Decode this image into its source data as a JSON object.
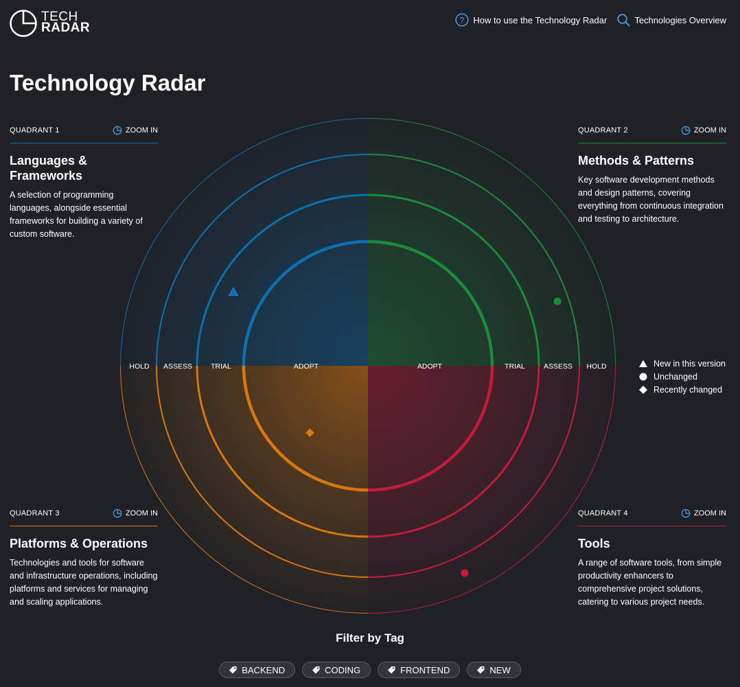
{
  "header": {
    "logo": {
      "line1": "TECH",
      "line2": "RADAR"
    },
    "nav": [
      {
        "label": "How to use the Technology Radar",
        "icon": "help-circle-icon"
      },
      {
        "label": "Technologies Overview",
        "icon": "search-icon"
      }
    ]
  },
  "page_title": "Technology Radar",
  "quadrants": [
    {
      "number_label": "QUADRANT 1",
      "zoom_label": "ZOOM IN",
      "title": "Languages & Frameworks",
      "description": "A selection of programming languages, alongside essential frameworks for building a variety of custom software.",
      "color": "#0e6fae"
    },
    {
      "number_label": "QUADRANT 2",
      "zoom_label": "ZOOM IN",
      "title": "Methods & Patterns",
      "description": "Key software development methods and design patterns, covering everything from continuous integration and testing to architecture.",
      "color": "#1c8a3c"
    },
    {
      "number_label": "QUADRANT 3",
      "zoom_label": "ZOOM IN",
      "title": "Platforms & Operations",
      "description": "Technologies and tools for software and infrastructure operations, including platforms and services for managing and scaling applications.",
      "color": "#d8770d"
    },
    {
      "number_label": "QUADRANT 4",
      "zoom_label": "ZOOM IN",
      "title": "Tools",
      "description": "A range of software tools, from simple productivity enhancers to comprehensive project solutions, catering to various project needs.",
      "color": "#c21a3a"
    }
  ],
  "radar": {
    "rings_left": [
      "HOLD",
      "ASSESS",
      "TRIAL",
      "ADOPT"
    ],
    "rings_right": [
      "ADOPT",
      "TRIAL",
      "ASSESS",
      "HOLD"
    ]
  },
  "legend": [
    {
      "label": "New in this version",
      "icon": "triangle-icon"
    },
    {
      "label": "Unchanged",
      "icon": "circle-icon"
    },
    {
      "label": "Recently changed",
      "icon": "diamond-icon"
    }
  ],
  "filter": {
    "title": "Filter by Tag",
    "tags": [
      "BACKEND",
      "CODING",
      "FRONTEND",
      "NEW"
    ]
  }
}
